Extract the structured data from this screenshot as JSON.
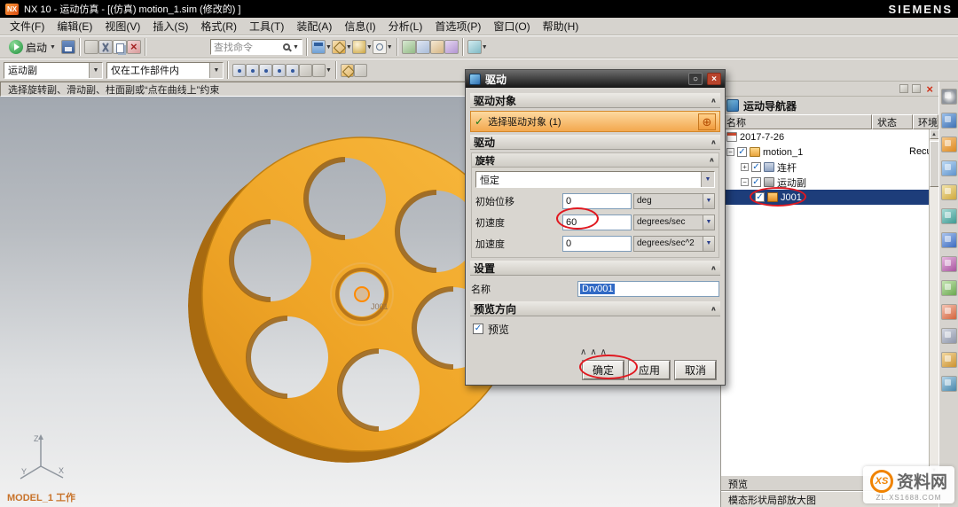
{
  "glyphs": {
    "dropdown": "▼",
    "collapse": "∧",
    "check": "✓",
    "close": "×",
    "reset": "○",
    "up": "▲",
    "down": "▼",
    "plus": "+",
    "minus": "−",
    "target": "⊕"
  },
  "titlebar": {
    "app_badge": "NX",
    "title": "NX 10 - 运动仿真 - [(仿真) motion_1.sim (修改的) ]",
    "brand": "SIEMENS"
  },
  "menubar": {
    "items": [
      "文件(F)",
      "编辑(E)",
      "视图(V)",
      "插入(S)",
      "格式(R)",
      "工具(T)",
      "装配(A)",
      "信息(I)",
      "分析(L)",
      "首选项(P)",
      "窗口(O)",
      "帮助(H)"
    ]
  },
  "toolbar1": {
    "start_label": "启动",
    "search_placeholder": "查找命令"
  },
  "toolbar2": {
    "filter_value": "运动副",
    "scope_value": "仅在工作部件内"
  },
  "prompt": {
    "text": "选择旋转副、滑动副、柱面副或“点在曲线上”约束"
  },
  "viewport": {
    "part_label": "MODEL_1 工作",
    "joint_label": "J001",
    "axes": {
      "x": "X",
      "y": "Y",
      "z": "Z"
    }
  },
  "dialog": {
    "title": "驱动",
    "sections": {
      "drive_object": {
        "header": "驱动对象",
        "row_label": "选择驱动对象 (1)"
      },
      "drive": {
        "header": "驱动",
        "group_header": "旋转",
        "profile_value": "恒定",
        "fields": [
          {
            "label": "初始位移",
            "value": "0",
            "unit": "deg"
          },
          {
            "label": "初速度",
            "value": "60",
            "unit": "degrees/sec"
          },
          {
            "label": "加速度",
            "value": "0",
            "unit": "degrees/sec^2"
          }
        ]
      },
      "settings": {
        "header": "设置",
        "name_label": "名称",
        "name_value": "Drv001"
      },
      "preview": {
        "header": "预览方向",
        "checkbox_label": "预览"
      }
    },
    "buttons": {
      "ok": "确定",
      "apply": "应用",
      "cancel": "取消"
    }
  },
  "navigator": {
    "title": "运动导航器",
    "columns": [
      "名称",
      "状态",
      "环境"
    ],
    "rows": [
      {
        "label": "2017-7-26",
        "status": "",
        "env": ""
      },
      {
        "label": "motion_1",
        "status": "",
        "env": "Recur"
      },
      {
        "label": "连杆",
        "status": "",
        "env": ""
      },
      {
        "label": "运动副",
        "status": "",
        "env": ""
      },
      {
        "label": "J001",
        "status": "",
        "env": ""
      }
    ],
    "bottom": {
      "preview": "预览",
      "zoom_label": "模态形状局部放大图"
    }
  },
  "watermark": {
    "brand": "XS",
    "line1": "资料网",
    "line2": "ZL.XS1688.COM"
  }
}
